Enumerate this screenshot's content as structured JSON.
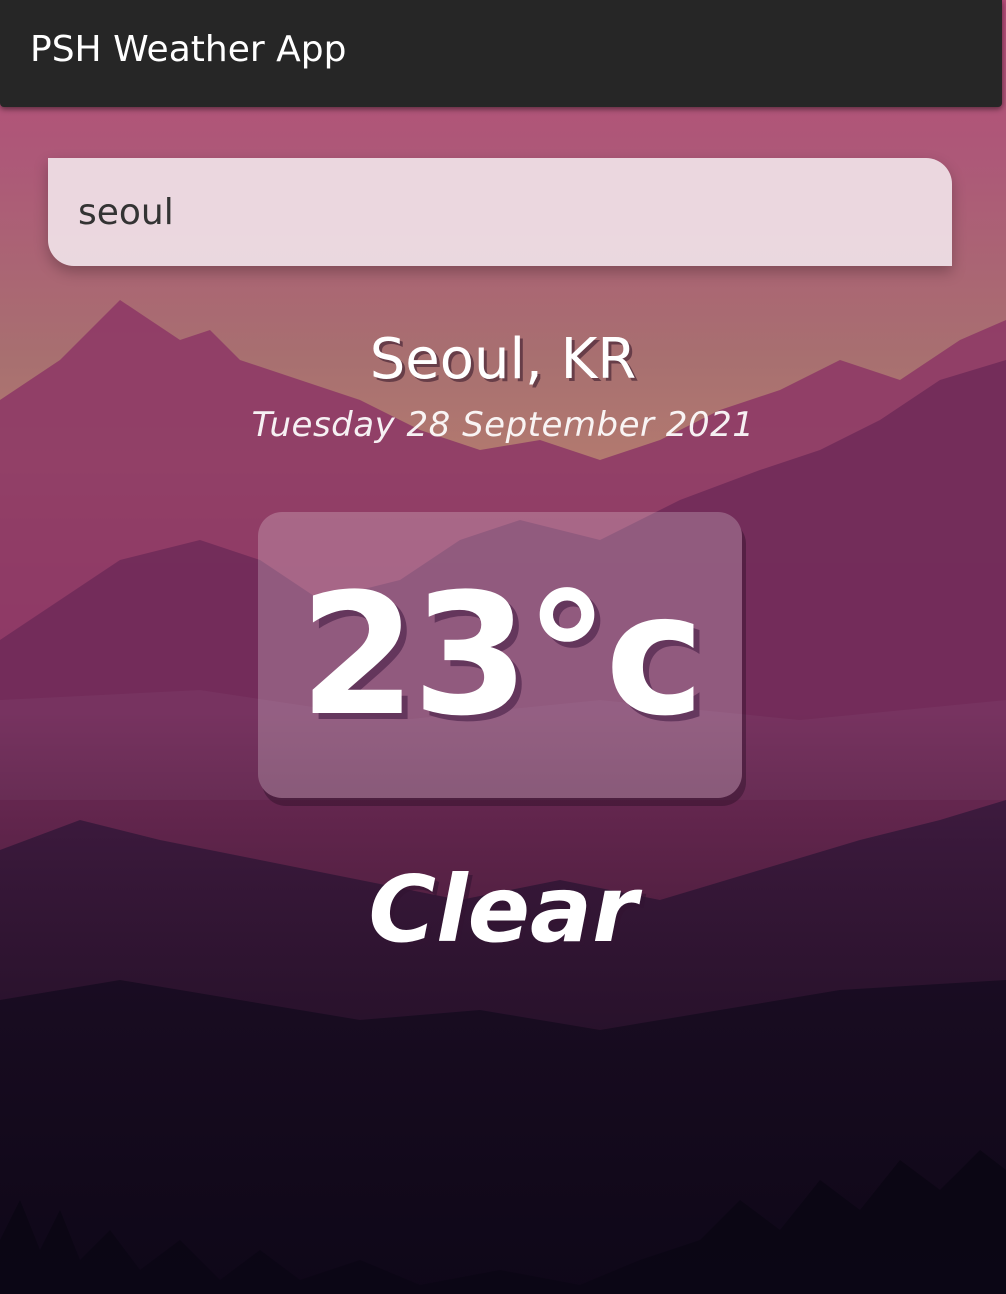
{
  "header": {
    "title": "PSH Weather App"
  },
  "search": {
    "value": "seoul",
    "placeholder": ""
  },
  "location": {
    "city": "Seoul, KR",
    "date": "Tuesday 28 September 2021"
  },
  "temperature": {
    "display": "23°c"
  },
  "weather": {
    "condition": "Clear"
  },
  "colors": {
    "header_bg": "#262626",
    "sky_top": "#b84c7a",
    "sky_mid": "#a87072",
    "mountain_dark": "#1a0f24"
  }
}
